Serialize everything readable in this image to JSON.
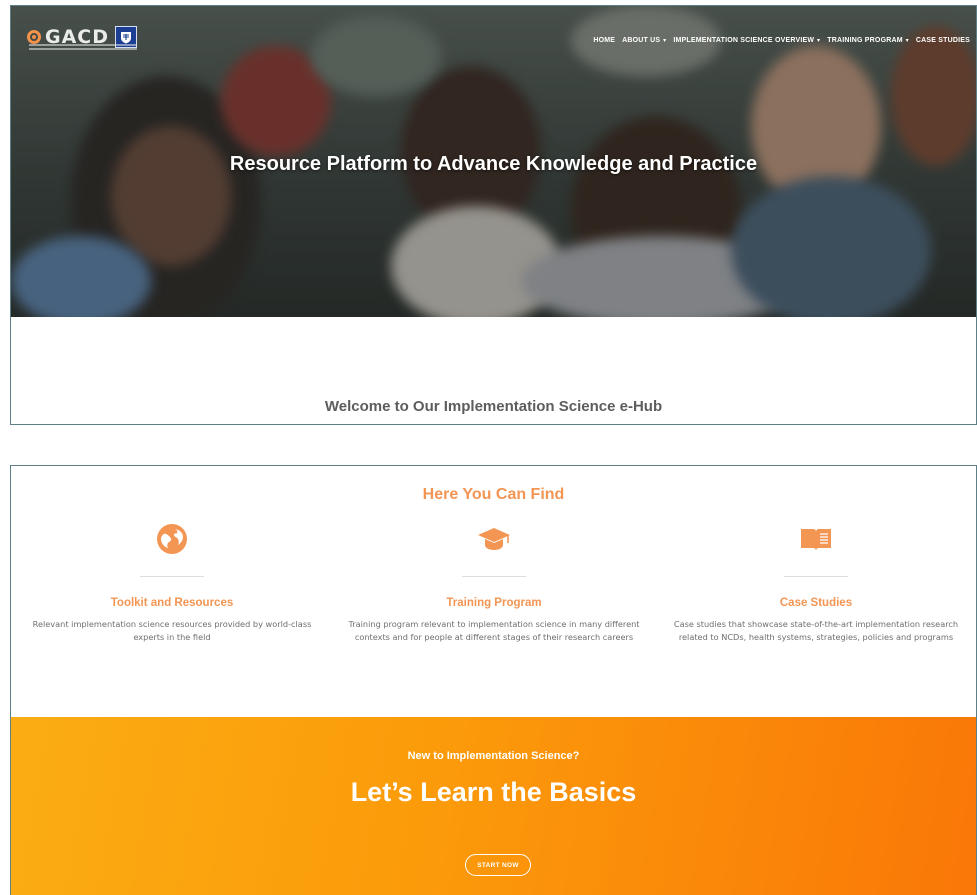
{
  "brand": {
    "logo_text": "GACD",
    "icon": "gacd-ring-icon",
    "partner_icon": "university-crest-icon"
  },
  "nav": {
    "items": [
      {
        "label": "HOME",
        "dropdown": false
      },
      {
        "label": "ABOUT US",
        "dropdown": true
      },
      {
        "label": "IMPLEMENTATION SCIENCE OVERVIEW",
        "dropdown": true
      },
      {
        "label": "TRAINING PROGRAM",
        "dropdown": true
      },
      {
        "label": "CASE STUDIES",
        "dropdown": false
      }
    ]
  },
  "hero": {
    "title": "Resource Platform to Advance Knowledge and Practice"
  },
  "welcome": {
    "heading": "Welcome to Our Implementation Science e-Hub"
  },
  "find": {
    "heading": "Here You Can Find",
    "columns": [
      {
        "icon": "globe-icon",
        "title": "Toolkit and Resources",
        "description": "Relevant implementation science resources provided by world-class experts in the field"
      },
      {
        "icon": "graduation-cap-icon",
        "title": "Training Program",
        "description": "Training program relevant to implementation science in many different contexts and for people at different stages of their research careers"
      },
      {
        "icon": "open-book-icon",
        "title": "Case Studies",
        "description": "Case studies that showcase state-of-the-art implementation research related to NCDs, health systems, strategies, policies and programs"
      }
    ]
  },
  "cta": {
    "subtitle": "New to Implementation Science?",
    "title": "Let’s Learn the Basics",
    "button_label": "START NOW"
  },
  "colors": {
    "accent": "#f39553",
    "cta_start": "#fbad13",
    "cta_end": "#fa7708",
    "panel_border": "#5f7f86"
  }
}
